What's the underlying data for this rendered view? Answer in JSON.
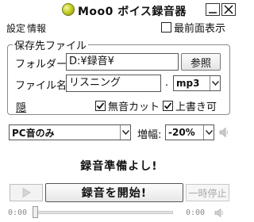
{
  "window": {
    "title": "Moo0 ボイス録音器"
  },
  "menu": {
    "settings": "設定",
    "info": "情報",
    "always_on_top_label": "最前面表示",
    "always_on_top_checked": false
  },
  "save_group": {
    "title": "保存先ファイル",
    "folder_label": "フォルダー:",
    "folder_value": "D:¥録音¥",
    "browse_label": "参照",
    "filename_label": "ファイル名:",
    "filename_value": "リスニング",
    "ext_dot": ".",
    "format_selected": "mp3",
    "hide_link": "隠",
    "silence_cut_label": "無音カット",
    "silence_cut_checked": true,
    "overwrite_label": "上書き可",
    "overwrite_checked": true
  },
  "source": {
    "selected": "PC音のみ",
    "amp_label": "増幅:",
    "amp_selected": "-20%"
  },
  "status": {
    "message": "録音準備よし!"
  },
  "controls": {
    "record_label": "録音を開始!",
    "pause_label": "一時停止"
  },
  "time": {
    "current": "0:00",
    "end": "0:00"
  },
  "seek": {
    "position": 0
  }
}
